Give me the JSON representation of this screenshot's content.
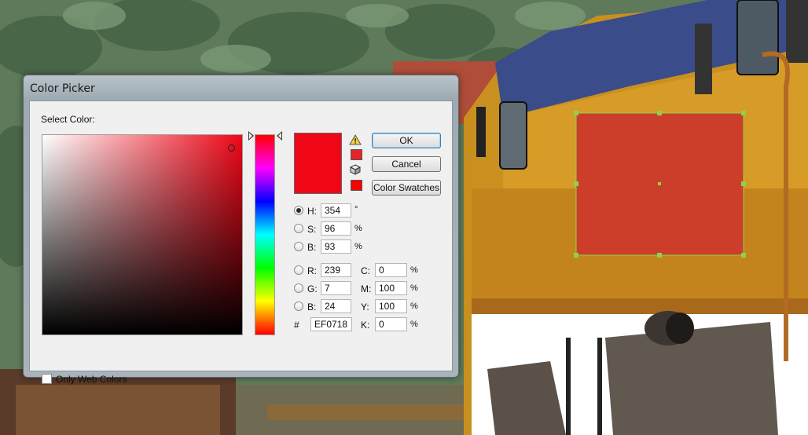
{
  "dialog": {
    "title": "Color Picker",
    "select_label": "Select Color:",
    "only_web_label": "Only Web Colors",
    "buttons": {
      "ok": "OK",
      "cancel": "Cancel",
      "swatches": "Color Swatches"
    },
    "current_color": "#EF0718",
    "hsb": {
      "h": {
        "label": "H:",
        "value": "354",
        "unit": "°",
        "selected": true
      },
      "s": {
        "label": "S:",
        "value": "96",
        "unit": "%"
      },
      "b": {
        "label": "B:",
        "value": "93",
        "unit": "%"
      }
    },
    "rgb": {
      "r": {
        "label": "R:",
        "value": "239"
      },
      "g": {
        "label": "G:",
        "value": "7"
      },
      "b": {
        "label": "B:",
        "value": "24"
      }
    },
    "cmyk": {
      "c": {
        "label": "C:",
        "value": "0",
        "unit": "%"
      },
      "m": {
        "label": "M:",
        "value": "100",
        "unit": "%"
      },
      "y": {
        "label": "Y:",
        "value": "100",
        "unit": "%"
      },
      "k": {
        "label": "K:",
        "value": "0",
        "unit": "%"
      }
    },
    "hex": {
      "label": "#",
      "value": "EF0718"
    },
    "icons": [
      "warning-icon",
      "cube-icon"
    ]
  },
  "canvas": {
    "selected_shape_color": "#CC3E2A",
    "selection_color": "#8FD14F"
  }
}
